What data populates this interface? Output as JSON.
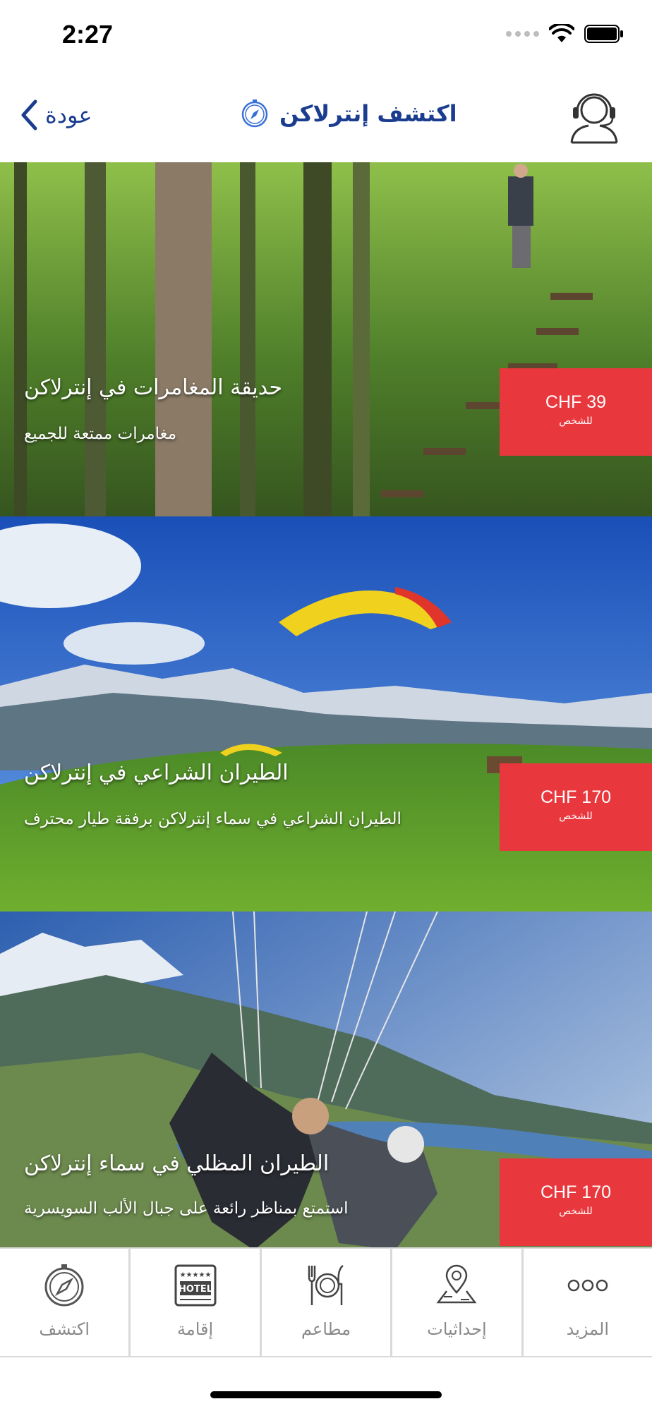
{
  "status_bar": {
    "time": "2:27"
  },
  "nav": {
    "back_label": "عودة",
    "title": "اكتشف إنترلاكن"
  },
  "cards": [
    {
      "title": "حديقة المغامرات في إنترلاكن",
      "subtitle": "مغامرات ممتعة للجميع",
      "price": "CHF 39",
      "price_unit": "للشخص"
    },
    {
      "title": "الطيران الشراعي في إنترلاكن",
      "subtitle": "الطيران الشراعي في سماء إنترلاكن برفقة طيار محترف",
      "price": "CHF 170",
      "price_unit": "للشخص"
    },
    {
      "title": "الطيران المظلي في سماء إنترلاكن",
      "subtitle": "استمتع بمناظر رائعة على جبال الألب السويسرية",
      "price": "CHF 170",
      "price_unit": "للشخص"
    }
  ],
  "tabs": [
    {
      "label": "اكتشف",
      "icon": "compass-icon"
    },
    {
      "label": "إقامة",
      "icon": "hotel-icon",
      "icon_text": "HOTEL"
    },
    {
      "label": "مطاعم",
      "icon": "restaurant-icon"
    },
    {
      "label": "إحداثيات",
      "icon": "map-pin-icon"
    },
    {
      "label": "المزيد",
      "icon": "more-icon"
    }
  ],
  "colors": {
    "accent": "#1b3d8f",
    "price_badge": "#e8383d",
    "tab_label": "#8a8a8a"
  }
}
